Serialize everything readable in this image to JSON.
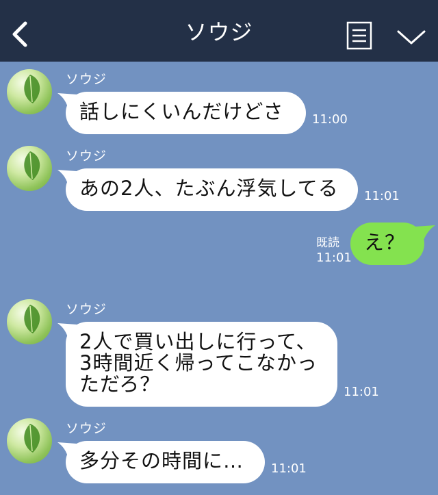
{
  "header": {
    "title": "ソウジ",
    "back_icon": "chevron-left-icon",
    "note_icon": "notes-icon",
    "menu_icon": "chevron-down-icon"
  },
  "colors": {
    "header_bg": "#233047",
    "chat_bg": "#7292c1",
    "incoming_bubble": "#ffffff",
    "outgoing_bubble": "#84e24f"
  },
  "messages": [
    {
      "sender": "ソウジ",
      "text": "話しにくいんだけどさ",
      "time": "11:00",
      "direction": "incoming"
    },
    {
      "sender": "ソウジ",
      "text": "あの2人、たぶん浮気してる",
      "time": "11:01",
      "direction": "incoming"
    },
    {
      "text": "え？",
      "time": "11:01",
      "read_label": "既読",
      "direction": "outgoing"
    },
    {
      "sender": "ソウジ",
      "text": "2人で買い出しに行って、\n3時間近く帰ってこなかっ\nただろ？",
      "time": "11:01",
      "direction": "incoming"
    },
    {
      "sender": "ソウジ",
      "text": "多分その時間に…",
      "time": "11:01",
      "direction": "incoming"
    }
  ]
}
